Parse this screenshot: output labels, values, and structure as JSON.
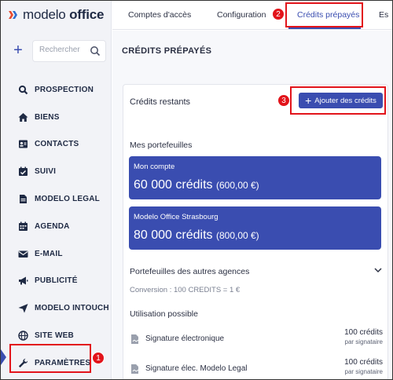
{
  "brand": {
    "logo_text_a": "modelo",
    "logo_text_b": "office"
  },
  "search": {
    "placeholder": "Rechercher"
  },
  "sidebar": {
    "items": [
      {
        "label": "PROSPECTION",
        "icon": "search-icon"
      },
      {
        "label": "BIENS",
        "icon": "home-icon"
      },
      {
        "label": "CONTACTS",
        "icon": "contact-card-icon"
      },
      {
        "label": "SUIVI",
        "icon": "calendar-check-icon"
      },
      {
        "label": "MODELO LEGAL",
        "icon": "document-icon"
      },
      {
        "label": "AGENDA",
        "icon": "calendar-icon"
      },
      {
        "label": "E-MAIL",
        "icon": "envelope-icon"
      },
      {
        "label": "PUBLICITÉ",
        "icon": "megaphone-icon"
      },
      {
        "label": "MODELO INTOUCH",
        "icon": "send-icon"
      },
      {
        "label": "SITE WEB",
        "icon": "globe-icon"
      },
      {
        "label": "PARAMÈTRES",
        "icon": "wrench-icon"
      }
    ]
  },
  "tabs": [
    {
      "label": "Comptes d'accès"
    },
    {
      "label": "Configuration"
    },
    {
      "label": "Crédits prépayés",
      "active": true
    },
    {
      "label": "Es"
    }
  ],
  "steps": {
    "one": "1",
    "two": "2",
    "three": "3"
  },
  "main": {
    "page_title": "CRÉDITS PRÉPAYÉS",
    "card_title": "Crédits restants",
    "add_button": "Ajouter des crédits",
    "wallets_title": "Mes portefeuilles",
    "wallets": [
      {
        "name": "Mon compte",
        "credits": "60 000 crédits",
        "eur": "(600,00 €)"
      },
      {
        "name": "Modelo Office Strasbourg",
        "credits": "80 000 crédits",
        "eur": "(800,00 €)"
      }
    ],
    "other_agencies": "Portefeuilles des autres agences",
    "conversion": "Conversion : 100 CREDITS = 1 €",
    "usage_title": "Utilisation possible",
    "usage": [
      {
        "label": "Signature électronique",
        "cost": "100 crédits",
        "unit": "par signataire"
      },
      {
        "label": "Signature élec. Modelo Legal",
        "cost": "100 crédits",
        "unit": "par signataire"
      }
    ]
  },
  "colors": {
    "accent": "#3a4db0",
    "annotation": "#e2141b"
  }
}
